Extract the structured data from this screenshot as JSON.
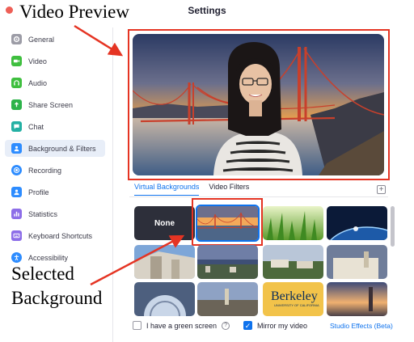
{
  "window": {
    "title": "Settings"
  },
  "annotations": {
    "video_preview": "Video Preview",
    "selected_line1": "Selected",
    "selected_line2": "Background"
  },
  "sidebar": {
    "items": [
      {
        "label": "General",
        "icon": "gear-icon",
        "color": "#9c9ca6"
      },
      {
        "label": "Video",
        "icon": "video-camera-icon",
        "color": "#3fbf3f"
      },
      {
        "label": "Audio",
        "icon": "headphones-icon",
        "color": "#3fbf3f"
      },
      {
        "label": "Share Screen",
        "icon": "share-screen-icon",
        "color": "#2db34a"
      },
      {
        "label": "Chat",
        "icon": "chat-bubble-icon",
        "color": "#24b0a4"
      },
      {
        "label": "Background & Filters",
        "icon": "person-background-icon",
        "color": "#2d8cff"
      },
      {
        "label": "Recording",
        "icon": "record-icon",
        "color": "#2d8cff"
      },
      {
        "label": "Profile",
        "icon": "profile-icon",
        "color": "#2d8cff"
      },
      {
        "label": "Statistics",
        "icon": "bar-chart-icon",
        "color": "#8d6ee8"
      },
      {
        "label": "Keyboard Shortcuts",
        "icon": "keyboard-icon",
        "color": "#8d6ee8"
      },
      {
        "label": "Accessibility",
        "icon": "accessibility-icon",
        "color": "#2d8cff"
      }
    ],
    "active_index": 5
  },
  "tabs": [
    {
      "label": "Virtual Backgrounds",
      "active": true
    },
    {
      "label": "Video Filters",
      "active": false
    }
  ],
  "add_button": "+",
  "backgrounds": [
    {
      "name": "none",
      "label": "None"
    },
    {
      "name": "golden-gate-bridge",
      "selected": true
    },
    {
      "name": "grass"
    },
    {
      "name": "earth-from-space"
    },
    {
      "name": "berkeley-sather-gate"
    },
    {
      "name": "berkeley-bay-view"
    },
    {
      "name": "berkeley-campus-aerial"
    },
    {
      "name": "berkeley-building"
    },
    {
      "name": "berkeley-campanile"
    },
    {
      "name": "berkeley-library-dome"
    },
    {
      "name": "berkeley-city-view"
    },
    {
      "name": "berkeley-hillside"
    },
    {
      "name": "berkeley-logo",
      "label": "Berkeley",
      "sub": "UNIVERSITY OF CALIFORNIA"
    },
    {
      "name": "berkeley-sunset"
    }
  ],
  "options": {
    "green_screen": {
      "label": "I have a green screen",
      "checked": false
    },
    "mirror": {
      "label": "Mirror my video",
      "checked": true
    },
    "studio_effects": "Studio Effects (Beta)"
  },
  "colors": {
    "accent": "#0e72ed",
    "annotation_red": "#e53423"
  }
}
